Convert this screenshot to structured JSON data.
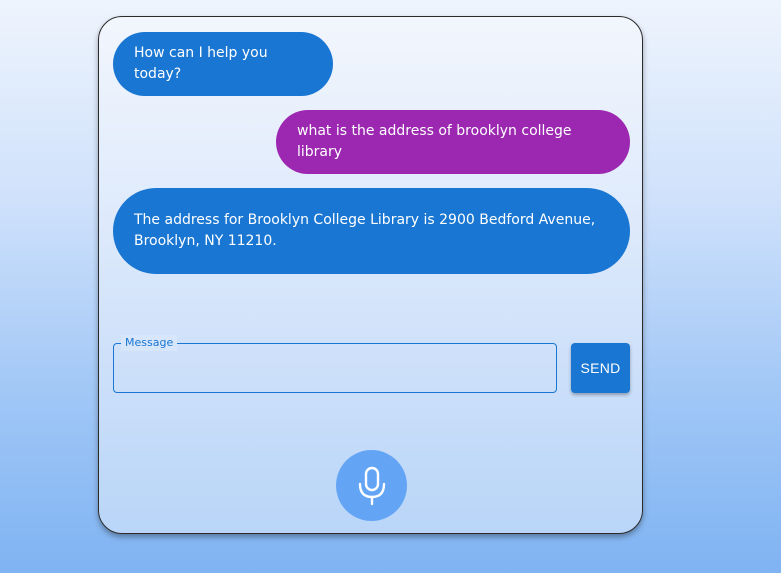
{
  "chat": {
    "messages": [
      {
        "role": "bot",
        "text": "How can I help you today?"
      },
      {
        "role": "user",
        "text": "what is the address of brooklyn college library"
      },
      {
        "role": "bot",
        "text": "The address for Brooklyn College Library is 2900 Bedford Avenue, Brooklyn, NY 11210."
      }
    ]
  },
  "input": {
    "label": "Message",
    "value": ""
  },
  "send_button": {
    "label": "SEND"
  },
  "mic_button": {
    "icon": "microphone-icon"
  },
  "colors": {
    "bot_bubble": "#1976d2",
    "user_bubble": "#9c27b0",
    "accent": "#1976d2",
    "mic_button": "#64a4f4"
  }
}
